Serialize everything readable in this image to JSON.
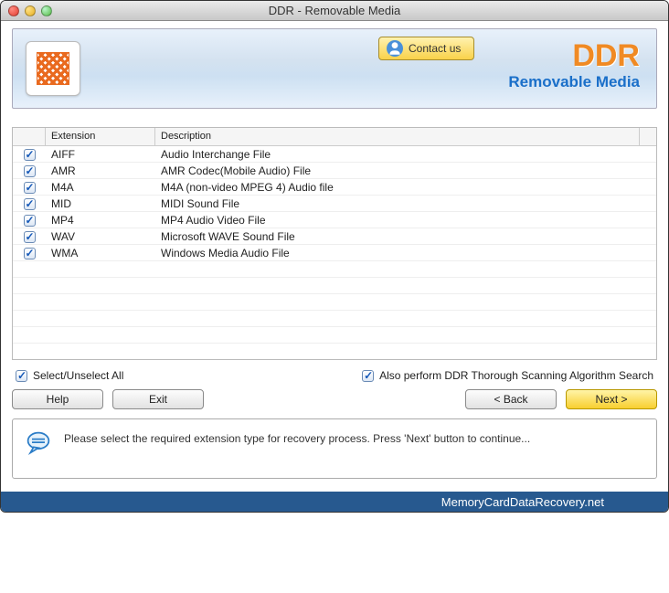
{
  "window": {
    "title": "DDR - Removable Media"
  },
  "header": {
    "contact_label": "Contact us",
    "brand": "DDR",
    "brand_sub": "Removable Media"
  },
  "table": {
    "columns": {
      "ext": "Extension",
      "desc": "Description"
    },
    "rows": [
      {
        "checked": true,
        "ext": "AIFF",
        "desc": "Audio Interchange File"
      },
      {
        "checked": true,
        "ext": "AMR",
        "desc": "AMR Codec(Mobile Audio) File"
      },
      {
        "checked": true,
        "ext": "M4A",
        "desc": "M4A (non-video MPEG 4) Audio file"
      },
      {
        "checked": true,
        "ext": "MID",
        "desc": "MIDI Sound File"
      },
      {
        "checked": true,
        "ext": "MP4",
        "desc": "MP4 Audio Video File"
      },
      {
        "checked": true,
        "ext": "WAV",
        "desc": "Microsoft WAVE Sound File"
      },
      {
        "checked": true,
        "ext": "WMA",
        "desc": "Windows Media Audio File"
      }
    ],
    "empty_rows": 6
  },
  "options": {
    "select_all": {
      "checked": true,
      "label": "Select/Unselect All"
    },
    "thorough": {
      "checked": true,
      "label": "Also perform DDR Thorough Scanning Algorithm Search"
    }
  },
  "buttons": {
    "help": "Help",
    "exit": "Exit",
    "back": "< Back",
    "next": "Next >"
  },
  "info": {
    "text": "Please select the required extension type for recovery process. Press 'Next' button to continue..."
  },
  "footer": {
    "site": "MemoryCardDataRecovery.net"
  }
}
